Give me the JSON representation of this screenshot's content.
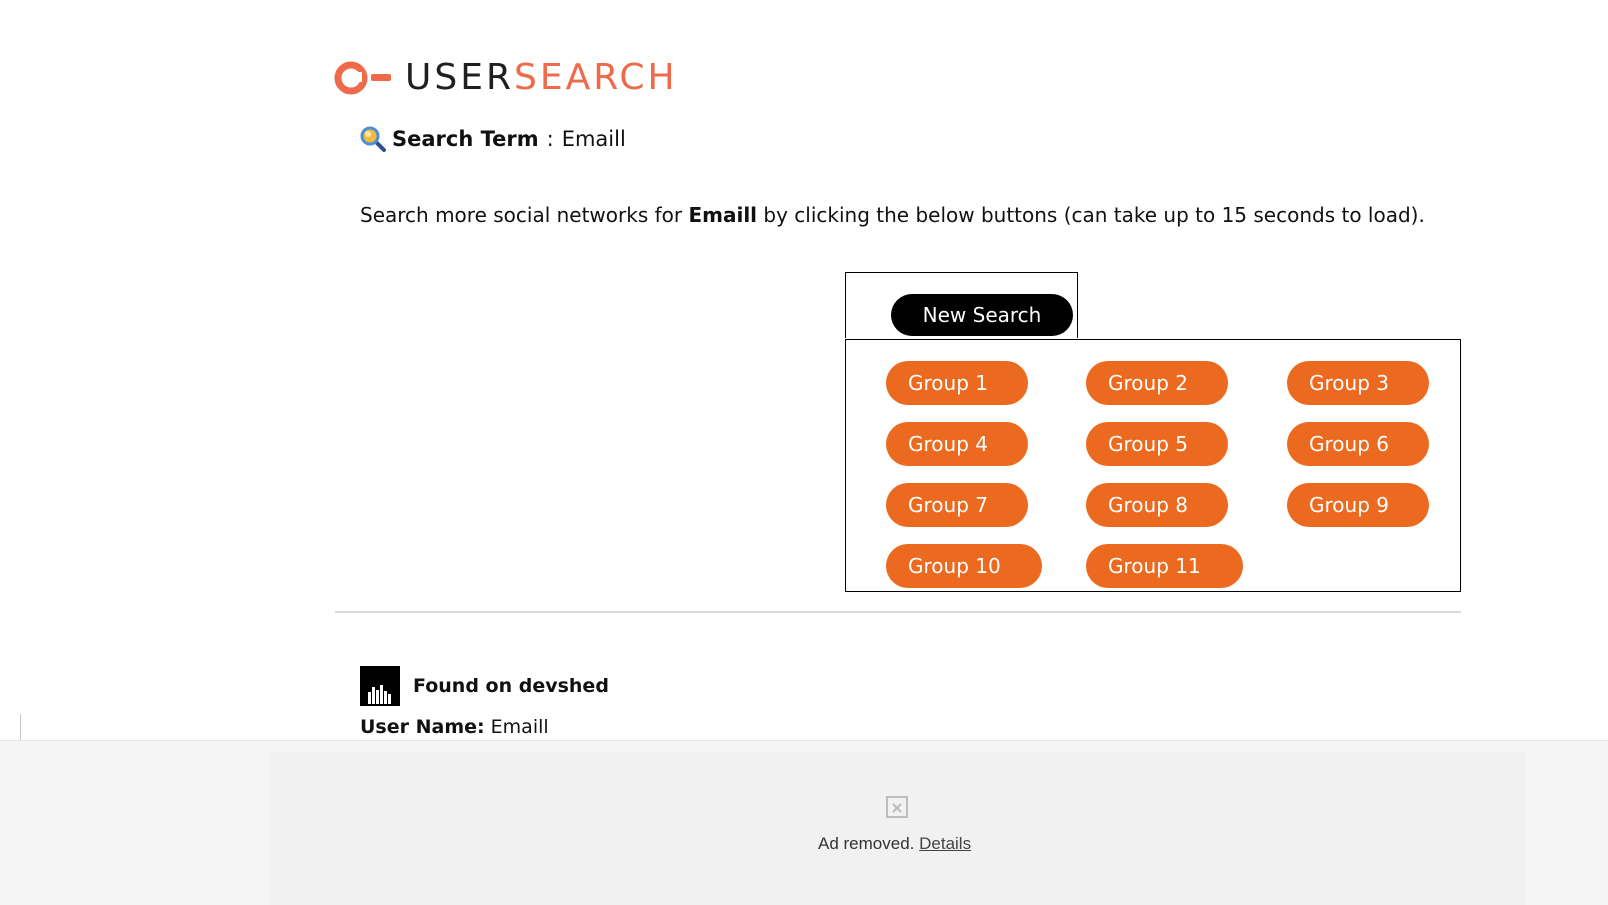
{
  "logo": {
    "text_user": "USER",
    "text_search": "SEARCH",
    "brand_color": "#ef6a4a",
    "icon": "usersearch-logo-icon"
  },
  "search_term": {
    "icon": "magnifier-icon",
    "label": "Search Term",
    "separator": ":",
    "value": "Emaill"
  },
  "description": {
    "prefix": "Search more social networks for ",
    "term": "Emaill",
    "suffix": " by clicking the below buttons (can take up to 15 seconds to load)."
  },
  "new_search": {
    "label": "New Search"
  },
  "groups": {
    "color": "#ec6a1f",
    "items": [
      {
        "label": "Group 1"
      },
      {
        "label": "Group 2"
      },
      {
        "label": "Group 3"
      },
      {
        "label": "Group 4"
      },
      {
        "label": "Group 5"
      },
      {
        "label": "Group 6"
      },
      {
        "label": "Group 7"
      },
      {
        "label": "Group 8"
      },
      {
        "label": "Group 9"
      },
      {
        "label": "Group 10"
      },
      {
        "label": "Group 11"
      }
    ]
  },
  "result": {
    "icon": "devshed-icon",
    "found_label": "Found on devshed",
    "username_label": "User Name:",
    "username_value": "Emaill"
  },
  "ad": {
    "icon": "broken-image-icon",
    "removed_text": "Ad removed.",
    "details_link": "Details"
  }
}
